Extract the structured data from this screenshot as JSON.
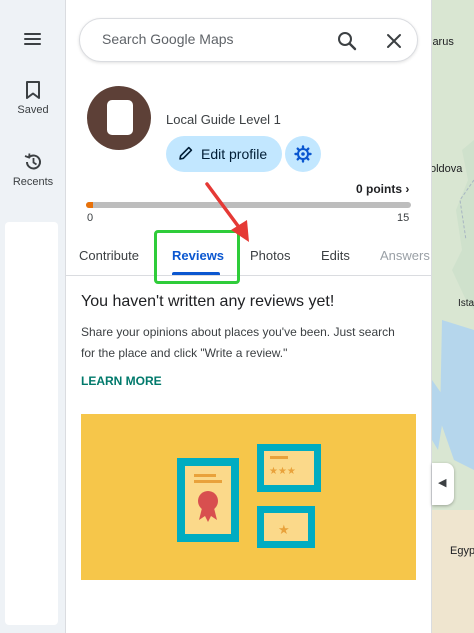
{
  "rail": {
    "saved_label": "Saved",
    "recents_label": "Recents"
  },
  "search": {
    "placeholder": "Search Google Maps"
  },
  "profile": {
    "level": "Local Guide Level 1",
    "edit_label": "Edit profile",
    "points_label": "0 points ›",
    "progress_fraction": 0.02,
    "progress_min": "0",
    "progress_max": "15"
  },
  "tabs": [
    "Contribute",
    "Reviews",
    "Photos",
    "Edits",
    "Answers"
  ],
  "active_tab": "Reviews",
  "content": {
    "heading": "You haven't written any reviews yet!",
    "description": "Share your opinions about places you've been. Just search for the place and click \"Write a review.\"",
    "learn_more": "LEARN MORE"
  },
  "map": {
    "labels": [
      "larus",
      "oldova",
      "Ista",
      "Egyp"
    ]
  },
  "colors": {
    "accent": "#0b57d0",
    "button_bg": "#c2e7ff",
    "highlight": "#2fcc3a",
    "arrow": "#e53935",
    "illustration_bg": "#f6c64a"
  }
}
